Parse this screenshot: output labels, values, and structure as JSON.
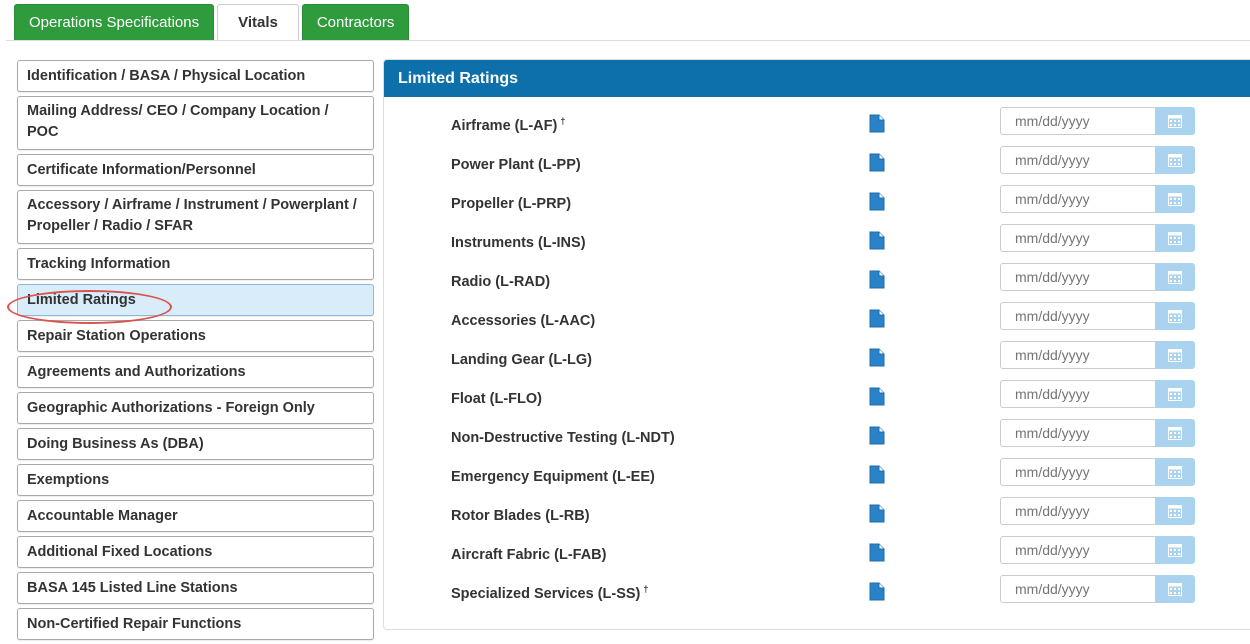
{
  "tabs": [
    {
      "label": "Operations Specifications",
      "active": false
    },
    {
      "label": "Vitals",
      "active": true
    },
    {
      "label": "Contractors",
      "active": false
    }
  ],
  "sidebar": {
    "items": [
      {
        "label": "Identification / BASA / Physical Location"
      },
      {
        "label": "Mailing Address/ CEO / Company Location / POC"
      },
      {
        "label": "Certificate Information/Personnel"
      },
      {
        "label": "Accessory / Airframe / Instrument / Powerplant / Propeller / Radio / SFAR"
      },
      {
        "label": "Tracking Information"
      },
      {
        "label": "Limited Ratings",
        "active": true
      },
      {
        "label": "Repair Station Operations"
      },
      {
        "label": "Agreements and Authorizations"
      },
      {
        "label": "Geographic Authorizations - Foreign Only"
      },
      {
        "label": "Doing Business As (DBA)"
      },
      {
        "label": "Exemptions"
      },
      {
        "label": "Accountable Manager"
      },
      {
        "label": "Additional Fixed Locations"
      },
      {
        "label": "BASA 145 Listed Line Stations"
      },
      {
        "label": "Non-Certified Repair Functions"
      }
    ]
  },
  "panel": {
    "title": "Limited Ratings",
    "date_placeholder": "mm/dd/yyyy",
    "ratings": [
      {
        "label": "Airframe (L-AF)",
        "mark": "†"
      },
      {
        "label": "Power Plant (L-PP)",
        "mark": ""
      },
      {
        "label": "Propeller (L-PRP)",
        "mark": ""
      },
      {
        "label": "Instruments (L-INS)",
        "mark": ""
      },
      {
        "label": "Radio (L-RAD)",
        "mark": ""
      },
      {
        "label": "Accessories (L-AAC)",
        "mark": ""
      },
      {
        "label": "Landing Gear (L-LG)",
        "mark": ""
      },
      {
        "label": "Float (L-FLO)",
        "mark": ""
      },
      {
        "label": "Non-Destructive Testing (L-NDT)",
        "mark": ""
      },
      {
        "label": "Emergency Equipment (L-EE)",
        "mark": ""
      },
      {
        "label": "Rotor Blades (L-RB)",
        "mark": ""
      },
      {
        "label": "Aircraft Fabric (L-FAB)",
        "mark": ""
      },
      {
        "label": "Specialized Services (L-SS)",
        "mark": "†"
      }
    ]
  },
  "colors": {
    "tab_green": "#2e9b3c",
    "panel_header_blue": "#0d70aa",
    "active_item_bg": "#d9ecfa",
    "highlight_circle": "#d9534f",
    "calendar_button": "#a9d3ee"
  },
  "icons": {
    "row_icon": "document-icon",
    "date_button_icon": "calendar-icon"
  }
}
